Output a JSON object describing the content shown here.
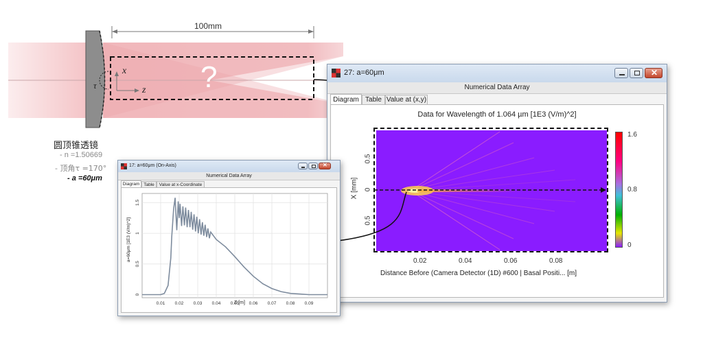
{
  "diagram": {
    "distance_label": "100mm",
    "question_mark": "?",
    "axis_x": "x",
    "axis_z": "z",
    "angle_label": "τ",
    "lens_title": "圆顶锥透镜",
    "param_n": "- n =1.50669",
    "param_tau": "- 顶角τ =170°",
    "param_a": "- a =60μm"
  },
  "window_main": {
    "title": "27: a=60μm",
    "header": "Numerical Data Array",
    "tabs": [
      "Diagram",
      "Table",
      "Value at (x,y)"
    ],
    "plot_title": "Data for Wavelength of 1.064 µm  [1E3 (V/m)^2]",
    "ylabel": "X [mm]",
    "xlabel": "Distance Before (Camera Detector (1D) #600 | Basal Positi... [m]",
    "x_ticks": [
      "0.02",
      "0.04",
      "0.06",
      "0.08"
    ],
    "y_ticks": [
      "0.5",
      "0",
      "0.5"
    ],
    "colorbar_ticks": [
      "1.6",
      "0.8",
      "0"
    ]
  },
  "window_small": {
    "title": "17: a=60μm (On-Axis)",
    "header": "Numerical Data Array",
    "tabs": [
      "Diagram",
      "Table",
      "Value at x-Coordinate"
    ],
    "ylabel": "a=60μm [1E3 (V/m)^2]",
    "xlabel": "Z [m]",
    "x_ticks": [
      "0.01",
      "0.02",
      "0.03",
      "0.04",
      "0.05",
      "0.06",
      "0.07",
      "0.08",
      "0.09"
    ],
    "y_ticks": [
      "1.5",
      "1",
      "0.5",
      "0"
    ]
  },
  "chart_data": {
    "type": "line",
    "xlabel": "Z [m]",
    "ylabel": "a=60μm [1E3 (V/m)^2]",
    "xlim": [
      0,
      0.1
    ],
    "ylim": [
      -0.05,
      1.65
    ],
    "series": [
      {
        "x": [
          0.0,
          0.01,
          0.012,
          0.014,
          0.0155,
          0.016,
          0.017,
          0.0178,
          0.018,
          0.0187,
          0.0195,
          0.02,
          0.0205,
          0.0213,
          0.022,
          0.0228,
          0.0235,
          0.0243,
          0.025,
          0.0258,
          0.0265,
          0.0273,
          0.028,
          0.0288,
          0.0295,
          0.0303,
          0.031,
          0.0318,
          0.0325,
          0.0333,
          0.034,
          0.0348,
          0.0355,
          0.0363,
          0.037,
          0.04,
          0.045,
          0.05,
          0.055,
          0.06,
          0.065,
          0.07,
          0.075,
          0.08,
          0.085,
          0.09,
          0.095,
          0.1
        ],
        "y": [
          0.0,
          0.0,
          0.02,
          0.15,
          0.6,
          0.95,
          1.4,
          1.58,
          1.45,
          1.05,
          1.52,
          1.25,
          1.48,
          1.12,
          1.44,
          1.13,
          1.42,
          1.1,
          1.38,
          1.1,
          1.35,
          1.06,
          1.31,
          1.03,
          1.27,
          1.0,
          1.23,
          0.98,
          1.18,
          0.96,
          1.14,
          0.94,
          1.08,
          0.92,
          1.02,
          0.9,
          0.78,
          0.62,
          0.45,
          0.3,
          0.18,
          0.1,
          0.05,
          0.02,
          0.01,
          0.0,
          0.0,
          0.0
        ]
      }
    ]
  },
  "colors": {
    "beam": "#f4c3c6",
    "beam_dark": "#eaa2a8",
    "heatmap_bg": "#8a1cff",
    "curve": "#7e8c9e"
  }
}
